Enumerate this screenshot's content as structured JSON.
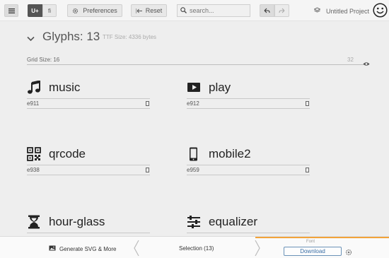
{
  "toolbar": {
    "menu_icon": "hamburger-icon",
    "unicode_toggle": "U+",
    "ligature_toggle": "fi",
    "preferences_label": "Preferences",
    "reset_label": "Reset",
    "search_placeholder": "search...",
    "project_name": "Untitled Project"
  },
  "header": {
    "title": "Glyphs: 13",
    "ttf_size": "TTF Size: 4336 bytes",
    "grid_size_label": "Grid Size: 16",
    "grid_size_value": "32"
  },
  "glyphs": [
    {
      "name": "music",
      "code": "e911",
      "icon": "music-icon"
    },
    {
      "name": "play",
      "code": "e912",
      "icon": "play-icon"
    },
    {
      "name": "qrcode",
      "code": "e938",
      "icon": "qrcode-icon"
    },
    {
      "name": "mobile2",
      "code": "e959",
      "icon": "mobile-icon"
    },
    {
      "name": "hour-glass",
      "code": "",
      "icon": "hourglass-icon"
    },
    {
      "name": "equalizer",
      "code": "",
      "icon": "equalizer-icon"
    }
  ],
  "bottom": {
    "generate_label": "Generate SVG & More",
    "selection_label": "Selection (13)",
    "font_label": "Font",
    "download_label": "Download"
  },
  "colors": {
    "accent": "#f2a33a",
    "toggle_active": "#555555",
    "download": "#3a6ea5"
  }
}
